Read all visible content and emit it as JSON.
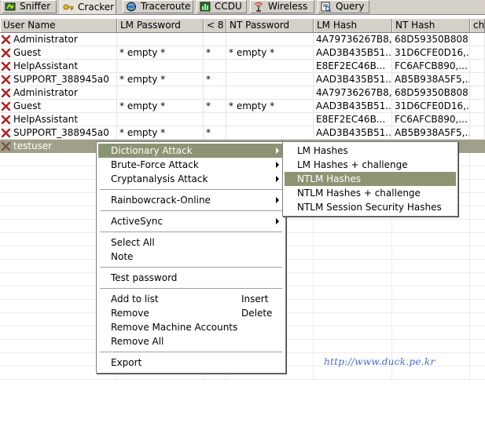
{
  "tabs": [
    {
      "label": "Sniffer",
      "icon": "sniffer-icon",
      "active": false
    },
    {
      "label": "Cracker",
      "icon": "key-icon",
      "active": true
    },
    {
      "label": "Traceroute",
      "icon": "traceroute-icon",
      "active": false
    },
    {
      "label": "CCDU",
      "icon": "ccdu-icon",
      "active": false
    },
    {
      "label": "Wireless",
      "icon": "wireless-icon",
      "active": false
    },
    {
      "label": "Query",
      "icon": "query-icon",
      "active": false
    }
  ],
  "grid": {
    "columns": [
      "User Name",
      "LM Password",
      "< 8",
      "NT Password",
      "LM Hash",
      "NT Hash",
      "ch"
    ],
    "rows": [
      {
        "user": "Administrator",
        "lm_password": "",
        "lt8": "",
        "nt_password": "",
        "lm_hash": "4A79736267B8,...",
        "nt_hash": "68D59350B808,..."
      },
      {
        "user": "Guest",
        "lm_password": "* empty *",
        "lt8": "*",
        "nt_password": "* empty *",
        "lm_hash": "AAD3B435B51...",
        "nt_hash": "31D6CFE0D16,..."
      },
      {
        "user": "HelpAssistant",
        "lm_password": "",
        "lt8": "",
        "nt_password": "",
        "lm_hash": "E8EF2EC46B...",
        "nt_hash": "FC6AFCB890,..."
      },
      {
        "user": "SUPPORT_388945a0",
        "lm_password": "* empty *",
        "lt8": "*",
        "nt_password": "",
        "lm_hash": "AAD3B435B51...",
        "nt_hash": "AB5B938A5F5,..."
      },
      {
        "user": "Administrator",
        "lm_password": "",
        "lt8": "",
        "nt_password": "",
        "lm_hash": "4A79736267B8,...",
        "nt_hash": "68D59350B808,..."
      },
      {
        "user": "Guest",
        "lm_password": "* empty *",
        "lt8": "*",
        "nt_password": "* empty *",
        "lm_hash": "AAD3B435B51...",
        "nt_hash": "31D6CFE0D16,..."
      },
      {
        "user": "HelpAssistant",
        "lm_password": "",
        "lt8": "",
        "nt_password": "",
        "lm_hash": "E8EF2EC46B...",
        "nt_hash": "FC6AFCB890,..."
      },
      {
        "user": "SUPPORT_388945a0",
        "lm_password": "* empty *",
        "lt8": "*",
        "nt_password": "",
        "lm_hash": "AAD3B435B51...",
        "nt_hash": "AB5B938A5F5,..."
      },
      {
        "user": "testuser",
        "lm_password": "",
        "lt8": "",
        "nt_password": "",
        "lm_hash": "",
        "nt_hash": "",
        "selected": true
      }
    ]
  },
  "context_menu": {
    "dictionary_attack": "Dictionary Attack",
    "brute_force_attack": "Brute-Force Attack",
    "cryptanalysis_attack": "Cryptanalysis Attack",
    "rainbowcrack_online": "Rainbowcrack-Online",
    "activesync": "ActiveSync",
    "select_all": "Select All",
    "note": "Note",
    "test_password": "Test password",
    "add_to_list": "Add to list",
    "add_to_list_shortcut": "Insert",
    "remove": "Remove",
    "remove_shortcut": "Delete",
    "remove_machine_accounts": "Remove Machine Accounts",
    "remove_all": "Remove All",
    "export": "Export"
  },
  "submenu": {
    "lm_hashes": "LM Hashes",
    "lm_hashes_challenge": "LM Hashes + challenge",
    "ntlm_hashes": "NTLM Hashes",
    "ntlm_hashes_challenge": "NTLM Hashes + challenge",
    "ntlm_session_security": "NTLM Session Security Hashes"
  },
  "watermark": "http://www.duck.pe.kr",
  "colors": {
    "menu_highlight": "#8b9473",
    "selected_row": "#a0a08a",
    "x_icon": "#b22222",
    "watermark": "#4169e1"
  }
}
